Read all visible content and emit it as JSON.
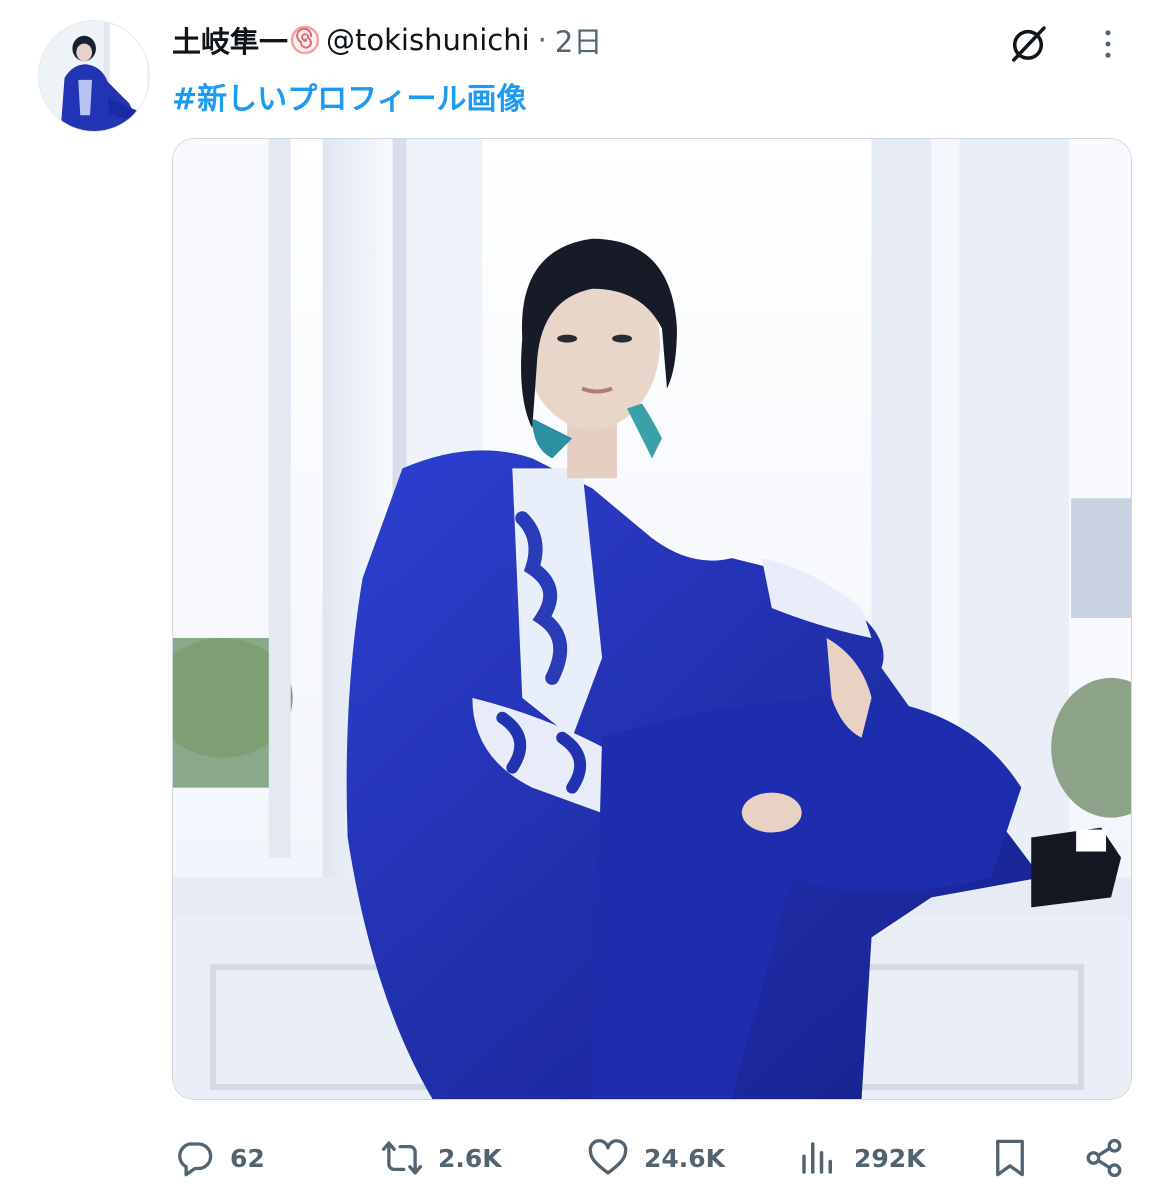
{
  "tweet": {
    "display_name": "土岐隼一",
    "handle": "@tokishunichi",
    "separator": "·",
    "time": "2日",
    "hashtag": "#新しいプロフィール画像",
    "avatar_icon": "profile-photo",
    "name_emoji": "naruto-fishcake-emoji"
  },
  "actions": {
    "reply_count": "62",
    "retweet_count": "2.6K",
    "like_count": "24.6K",
    "views_count": "292K"
  },
  "colors": {
    "hashtag": "#1d9bf0",
    "text_secondary": "#536471",
    "coat_blue": "#1f2fb0"
  }
}
